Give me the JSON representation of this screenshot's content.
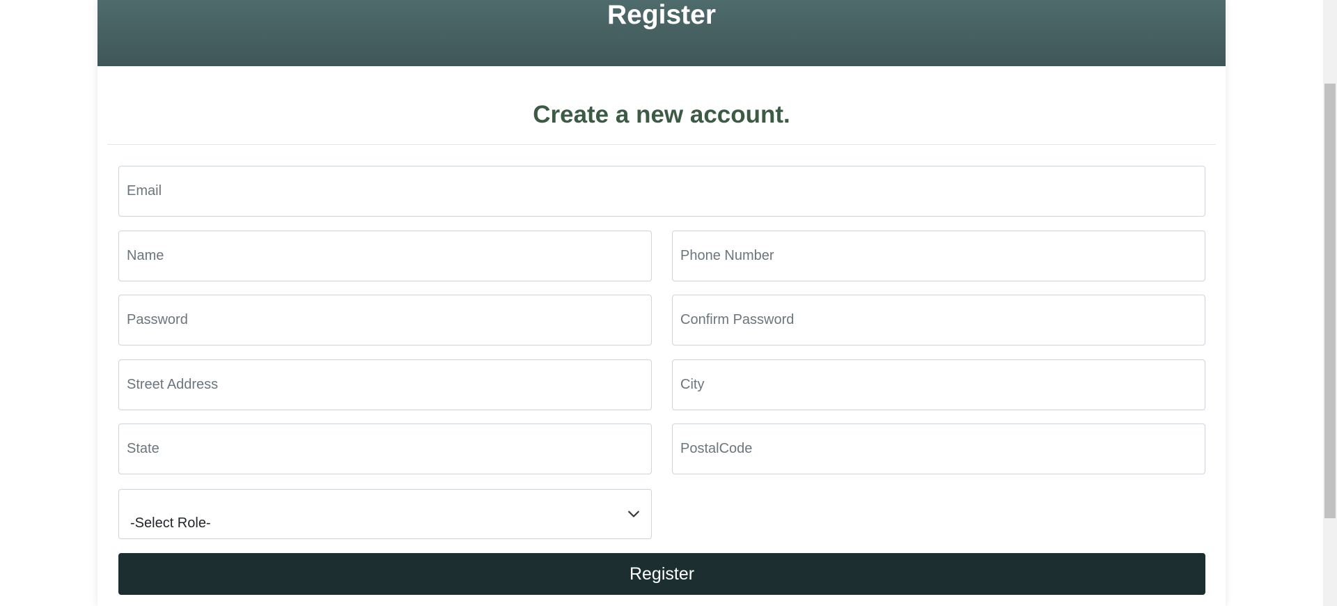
{
  "header": {
    "title": "Register"
  },
  "form": {
    "subtitle": "Create a new account.",
    "fields": {
      "email": {
        "placeholder": "Email",
        "value": ""
      },
      "name": {
        "placeholder": "Name",
        "value": ""
      },
      "phone": {
        "placeholder": "Phone Number",
        "value": ""
      },
      "password": {
        "placeholder": "Password",
        "value": ""
      },
      "confirm_password": {
        "placeholder": "Confirm Password",
        "value": ""
      },
      "street": {
        "placeholder": "Street Address",
        "value": ""
      },
      "city": {
        "placeholder": "City",
        "value": ""
      },
      "state": {
        "placeholder": "State",
        "value": ""
      },
      "postal": {
        "placeholder": "PostalCode",
        "value": ""
      }
    },
    "role_select": {
      "selected": "-Select Role-",
      "icon": "chevron-down-icon"
    },
    "submit_label": "Register"
  },
  "colors": {
    "header_bg": "#4a6466",
    "subtitle": "#3d5a45",
    "button_bg": "#1c2e30"
  }
}
